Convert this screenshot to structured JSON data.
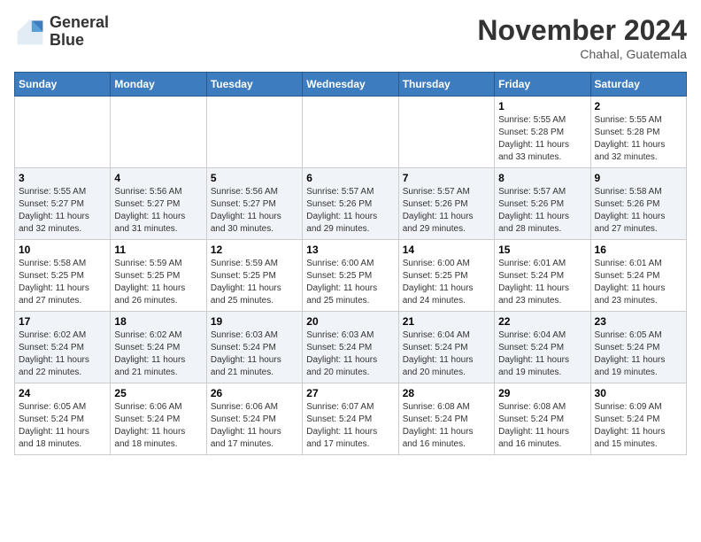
{
  "header": {
    "logo_line1": "General",
    "logo_line2": "Blue",
    "month_year": "November 2024",
    "location": "Chahal, Guatemala"
  },
  "weekdays": [
    "Sunday",
    "Monday",
    "Tuesday",
    "Wednesday",
    "Thursday",
    "Friday",
    "Saturday"
  ],
  "weeks": [
    [
      {
        "day": "",
        "info": ""
      },
      {
        "day": "",
        "info": ""
      },
      {
        "day": "",
        "info": ""
      },
      {
        "day": "",
        "info": ""
      },
      {
        "day": "",
        "info": ""
      },
      {
        "day": "1",
        "info": "Sunrise: 5:55 AM\nSunset: 5:28 PM\nDaylight: 11 hours\nand 33 minutes."
      },
      {
        "day": "2",
        "info": "Sunrise: 5:55 AM\nSunset: 5:28 PM\nDaylight: 11 hours\nand 32 minutes."
      }
    ],
    [
      {
        "day": "3",
        "info": "Sunrise: 5:55 AM\nSunset: 5:27 PM\nDaylight: 11 hours\nand 32 minutes."
      },
      {
        "day": "4",
        "info": "Sunrise: 5:56 AM\nSunset: 5:27 PM\nDaylight: 11 hours\nand 31 minutes."
      },
      {
        "day": "5",
        "info": "Sunrise: 5:56 AM\nSunset: 5:27 PM\nDaylight: 11 hours\nand 30 minutes."
      },
      {
        "day": "6",
        "info": "Sunrise: 5:57 AM\nSunset: 5:26 PM\nDaylight: 11 hours\nand 29 minutes."
      },
      {
        "day": "7",
        "info": "Sunrise: 5:57 AM\nSunset: 5:26 PM\nDaylight: 11 hours\nand 29 minutes."
      },
      {
        "day": "8",
        "info": "Sunrise: 5:57 AM\nSunset: 5:26 PM\nDaylight: 11 hours\nand 28 minutes."
      },
      {
        "day": "9",
        "info": "Sunrise: 5:58 AM\nSunset: 5:26 PM\nDaylight: 11 hours\nand 27 minutes."
      }
    ],
    [
      {
        "day": "10",
        "info": "Sunrise: 5:58 AM\nSunset: 5:25 PM\nDaylight: 11 hours\nand 27 minutes."
      },
      {
        "day": "11",
        "info": "Sunrise: 5:59 AM\nSunset: 5:25 PM\nDaylight: 11 hours\nand 26 minutes."
      },
      {
        "day": "12",
        "info": "Sunrise: 5:59 AM\nSunset: 5:25 PM\nDaylight: 11 hours\nand 25 minutes."
      },
      {
        "day": "13",
        "info": "Sunrise: 6:00 AM\nSunset: 5:25 PM\nDaylight: 11 hours\nand 25 minutes."
      },
      {
        "day": "14",
        "info": "Sunrise: 6:00 AM\nSunset: 5:25 PM\nDaylight: 11 hours\nand 24 minutes."
      },
      {
        "day": "15",
        "info": "Sunrise: 6:01 AM\nSunset: 5:24 PM\nDaylight: 11 hours\nand 23 minutes."
      },
      {
        "day": "16",
        "info": "Sunrise: 6:01 AM\nSunset: 5:24 PM\nDaylight: 11 hours\nand 23 minutes."
      }
    ],
    [
      {
        "day": "17",
        "info": "Sunrise: 6:02 AM\nSunset: 5:24 PM\nDaylight: 11 hours\nand 22 minutes."
      },
      {
        "day": "18",
        "info": "Sunrise: 6:02 AM\nSunset: 5:24 PM\nDaylight: 11 hours\nand 21 minutes."
      },
      {
        "day": "19",
        "info": "Sunrise: 6:03 AM\nSunset: 5:24 PM\nDaylight: 11 hours\nand 21 minutes."
      },
      {
        "day": "20",
        "info": "Sunrise: 6:03 AM\nSunset: 5:24 PM\nDaylight: 11 hours\nand 20 minutes."
      },
      {
        "day": "21",
        "info": "Sunrise: 6:04 AM\nSunset: 5:24 PM\nDaylight: 11 hours\nand 20 minutes."
      },
      {
        "day": "22",
        "info": "Sunrise: 6:04 AM\nSunset: 5:24 PM\nDaylight: 11 hours\nand 19 minutes."
      },
      {
        "day": "23",
        "info": "Sunrise: 6:05 AM\nSunset: 5:24 PM\nDaylight: 11 hours\nand 19 minutes."
      }
    ],
    [
      {
        "day": "24",
        "info": "Sunrise: 6:05 AM\nSunset: 5:24 PM\nDaylight: 11 hours\nand 18 minutes."
      },
      {
        "day": "25",
        "info": "Sunrise: 6:06 AM\nSunset: 5:24 PM\nDaylight: 11 hours\nand 18 minutes."
      },
      {
        "day": "26",
        "info": "Sunrise: 6:06 AM\nSunset: 5:24 PM\nDaylight: 11 hours\nand 17 minutes."
      },
      {
        "day": "27",
        "info": "Sunrise: 6:07 AM\nSunset: 5:24 PM\nDaylight: 11 hours\nand 17 minutes."
      },
      {
        "day": "28",
        "info": "Sunrise: 6:08 AM\nSunset: 5:24 PM\nDaylight: 11 hours\nand 16 minutes."
      },
      {
        "day": "29",
        "info": "Sunrise: 6:08 AM\nSunset: 5:24 PM\nDaylight: 11 hours\nand 16 minutes."
      },
      {
        "day": "30",
        "info": "Sunrise: 6:09 AM\nSunset: 5:24 PM\nDaylight: 11 hours\nand 15 minutes."
      }
    ]
  ]
}
